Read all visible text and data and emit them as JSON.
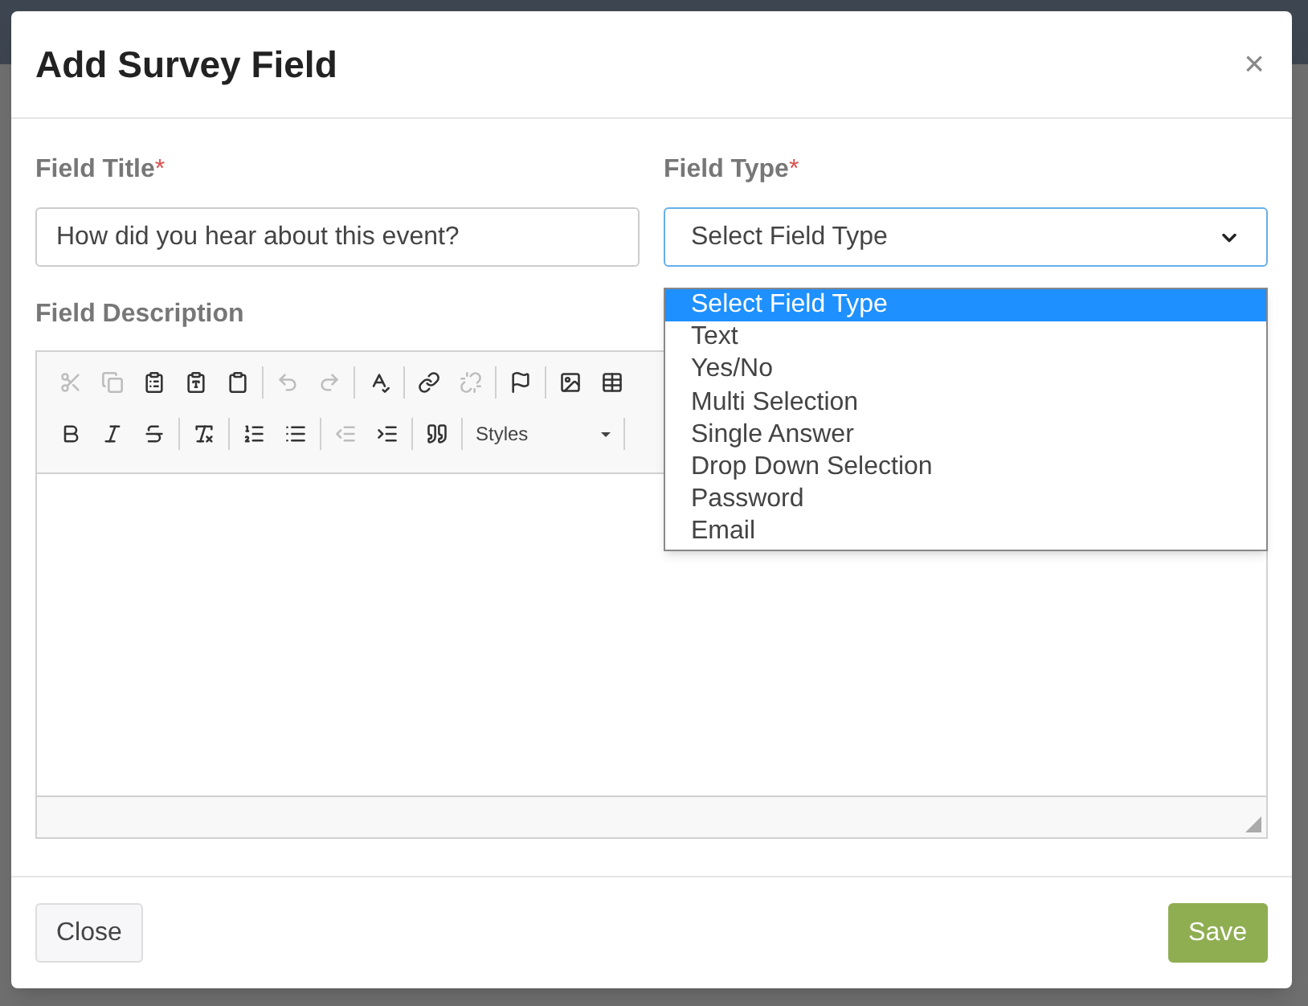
{
  "dialog": {
    "title": "Add Survey Field",
    "close": "×",
    "field_title": {
      "label": "Field Title",
      "required_mark": "*",
      "value": "How did you hear about this event?"
    },
    "field_type": {
      "label": "Field Type",
      "required_mark": "*",
      "value": "Select Field Type",
      "expanded": true,
      "options": [
        {
          "label": "Select Field Type",
          "selected": true
        },
        {
          "label": "Text",
          "selected": false
        },
        {
          "label": "Yes/No",
          "selected": false
        },
        {
          "label": "Multi Selection",
          "selected": false
        },
        {
          "label": "Single Answer",
          "selected": false
        },
        {
          "label": "Drop Down Selection",
          "selected": false
        },
        {
          "label": "Password",
          "selected": false
        },
        {
          "label": "Email",
          "selected": false
        }
      ]
    },
    "field_description": {
      "label": "Field Description",
      "toolbar_row_1": [
        {
          "disabled": true
        },
        {
          "disabled": true
        },
        {
          "disabled": false
        },
        {
          "disabled": false
        },
        {
          "disabled": false
        },
        {
          "disabled": true
        },
        {
          "disabled": true
        },
        {
          "disabled": false
        },
        {
          "disabled": false
        },
        {
          "disabled": true
        },
        {
          "disabled": false
        },
        {
          "disabled": false
        },
        {
          "disabled": false
        }
      ],
      "toolbar_row_2": [
        {
          "disabled": false
        },
        {
          "disabled": false
        },
        {
          "disabled": false
        },
        {
          "disabled": false
        },
        {
          "disabled": false
        },
        {
          "disabled": false
        },
        {
          "disabled": true
        },
        {
          "disabled": false
        },
        {
          "disabled": false
        }
      ],
      "styles_dropdown": "Styles"
    },
    "buttons": [
      {
        "label": "Close",
        "kind": "secondary"
      },
      {
        "label": "Save",
        "kind": "primary"
      }
    ]
  }
}
